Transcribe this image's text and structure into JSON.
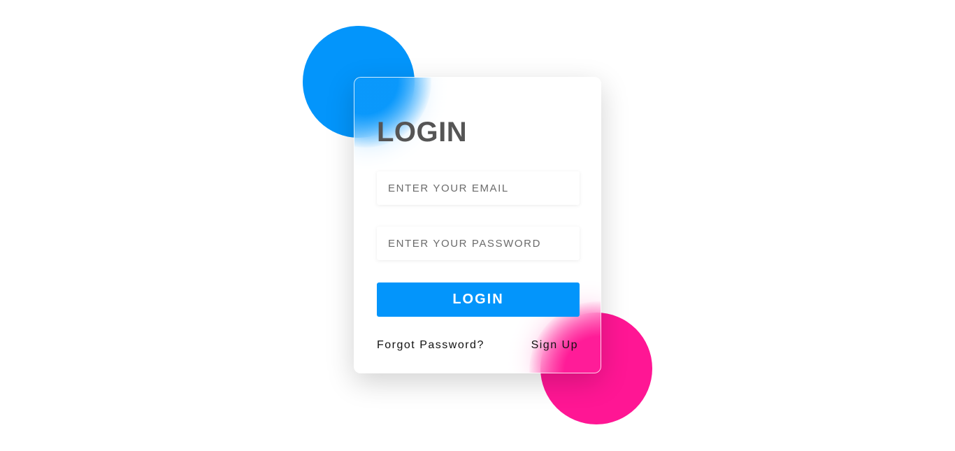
{
  "login_card": {
    "title": "LOGIN",
    "email_placeholder": "ENTER YOUR EMAIL",
    "password_placeholder": "ENTER YOUR PASSWORD",
    "submit_label": "LOGIN",
    "forgot_password_label": "Forgot Password?",
    "sign_up_label": "Sign Up"
  },
  "colors": {
    "accent_blue": "#0395fb",
    "accent_pink": "#ff1694",
    "title_gray": "#555555"
  }
}
